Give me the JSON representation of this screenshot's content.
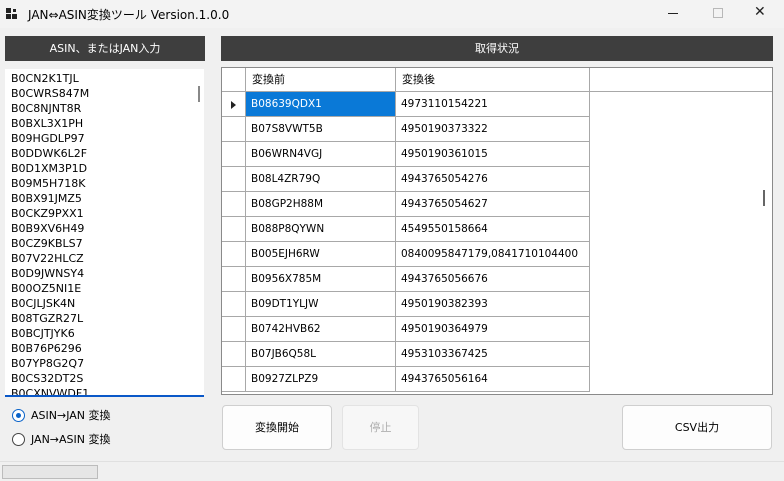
{
  "window": {
    "title": "JAN⇔ASIN変換ツール Version.1.0.0",
    "close_glyph": "✕"
  },
  "input_panel": {
    "header": "ASIN、またはJAN入力",
    "lines": [
      "B0CN2K1TJL",
      "B0CWRS847M",
      "B0C8NJNT8R",
      "B0BXL3X1PH",
      "B09HGDLP97",
      "B0DDWK6L2F",
      "B0D1XM3P1D",
      "B09M5H718K",
      "B0BX91JMZ5",
      "B0CKZ9PXX1",
      "B0B9XV6H49",
      "B0CZ9KBLS7",
      "B07V22HLCZ",
      "B0D9JWNSY4",
      "B00OZ5NI1E",
      "B0CJLJSK4N",
      "B08TGZR27L",
      "B0BCJTJYK6",
      "B0B76P6296",
      "B07YP8G2Q7",
      "B0CS32DT2S",
      "B0CXNVWDF1"
    ]
  },
  "mode": {
    "options": [
      "ASIN→JAN 変換",
      "JAN→ASIN 変換"
    ],
    "selected": 0
  },
  "status_panel": {
    "header": "取得状況",
    "columns": [
      "変換前",
      "変換後"
    ],
    "rows": [
      {
        "before": "B08639QDX1",
        "after": "4973110154221"
      },
      {
        "before": "B07S8VWT5B",
        "after": "4950190373322"
      },
      {
        "before": "B06WRN4VGJ",
        "after": "4950190361015"
      },
      {
        "before": "B08L4ZR79Q",
        "after": "4943765054276"
      },
      {
        "before": "B08GP2H88M",
        "after": "4943765054627"
      },
      {
        "before": "B088P8QYWN",
        "after": "4549550158664"
      },
      {
        "before": "B005EJH6RW",
        "after": "0840095847179,0841710104400"
      },
      {
        "before": "B0956X785M",
        "after": "4943765056676"
      },
      {
        "before": "B09DT1YLJW",
        "after": "4950190382393"
      },
      {
        "before": "B0742HVB62",
        "after": "4950190364979"
      },
      {
        "before": "B07JB6Q58L",
        "after": "4953103367425"
      },
      {
        "before": "B0927ZLPZ9",
        "after": "4943765056164"
      }
    ],
    "selected_row": 0
  },
  "buttons": {
    "start": "変換開始",
    "stop": "停止",
    "csv": "CSV出力"
  },
  "colors": {
    "header_bg": "#3e3e3e",
    "selection": "#0a79d7",
    "focus_border": "#0a58c8"
  },
  "icons": [
    "app-icon",
    "minimize-icon",
    "maximize-icon",
    "close-icon"
  ]
}
